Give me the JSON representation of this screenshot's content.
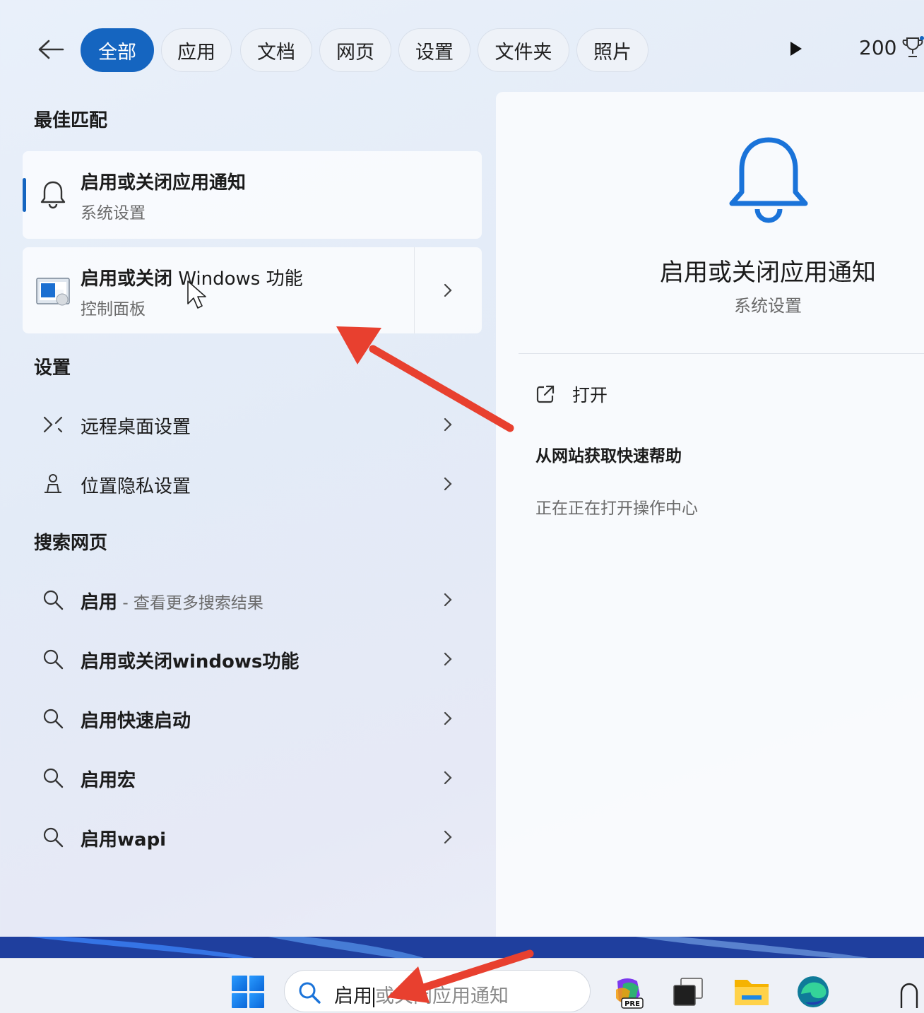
{
  "filters": {
    "tabs": [
      {
        "label": "全部",
        "active": true
      },
      {
        "label": "应用",
        "active": false
      },
      {
        "label": "文档",
        "active": false
      },
      {
        "label": "网页",
        "active": false
      },
      {
        "label": "设置",
        "active": false
      },
      {
        "label": "文件夹",
        "active": false
      },
      {
        "label": "照片",
        "active": false
      }
    ],
    "points": "200",
    "icons": {
      "back": "arrow-left-icon",
      "more": "play-icon",
      "rewards": "trophy-icon"
    }
  },
  "best_match": {
    "section_title": "最佳匹配",
    "items": [
      {
        "title": "启用或关闭应用通知",
        "subtitle": "系统设置",
        "icon": "bell-icon",
        "selected": true
      },
      {
        "title_bold": "启用或关闭",
        "title_rest": " Windows 功能",
        "subtitle": "控制面板",
        "icon": "control-panel-icon"
      }
    ]
  },
  "settings": {
    "section_title": "设置",
    "items": [
      {
        "label": "远程桌面设置",
        "icon": "remote-desktop-icon"
      },
      {
        "label": "位置隐私设置",
        "icon": "location-person-icon"
      }
    ]
  },
  "web": {
    "section_title": "搜索网页",
    "items": [
      {
        "label": "启用",
        "suffix": " - 查看更多搜索结果"
      },
      {
        "label": "启用或关闭windows功能",
        "suffix": ""
      },
      {
        "label": "启用快速启动",
        "suffix": ""
      },
      {
        "label": "启用宏",
        "suffix": ""
      },
      {
        "label": "启用wapi",
        "suffix": ""
      }
    ]
  },
  "preview": {
    "title": "启用或关闭应用通知",
    "subtitle": "系统设置",
    "icon": "bell-icon",
    "action_open": "打开",
    "help_title": "从网站获取快速帮助",
    "help_status": "正在正在打开操作中心"
  },
  "taskbar": {
    "search_typed": "启用",
    "search_ghost": "或关闭应用通知",
    "apps": [
      "copilot-pre-icon",
      "task-view-icon",
      "file-explorer-icon",
      "edge-icon"
    ]
  },
  "colors": {
    "accent": "#1565c0",
    "annotation_red": "#e8402f"
  }
}
